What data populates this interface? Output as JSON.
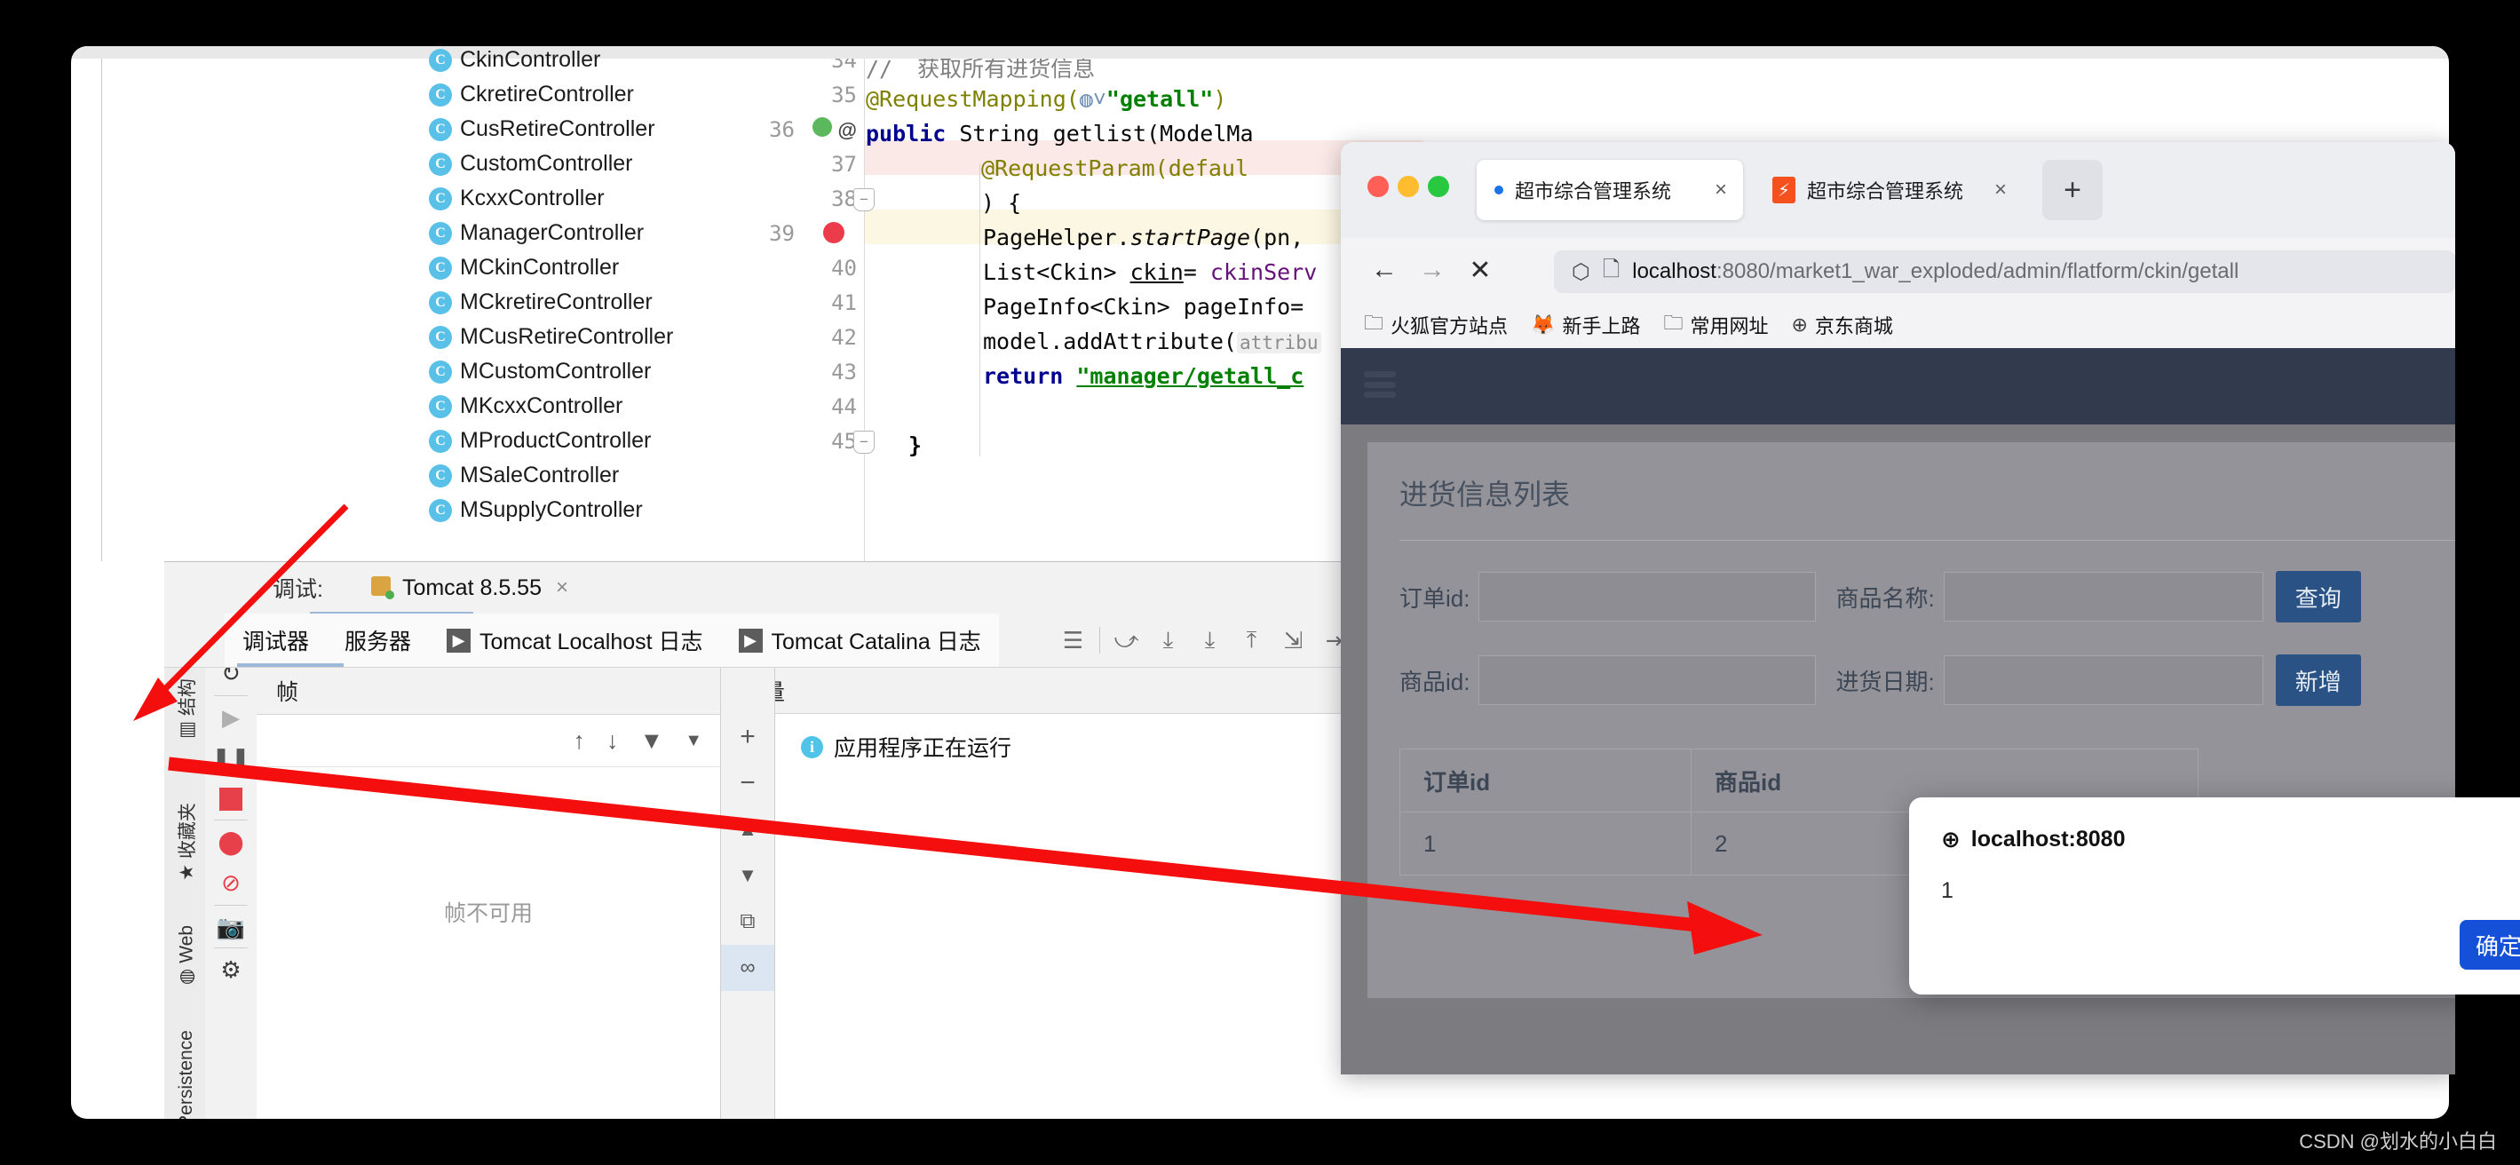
{
  "ide": {
    "project_tree": {
      "items": [
        {
          "label": "CkinController",
          "icon": "class-icon"
        },
        {
          "label": "CkretireController",
          "icon": "class-icon"
        },
        {
          "label": "CusRetireController",
          "icon": "class-icon"
        },
        {
          "label": "CustomController",
          "icon": "class-icon"
        },
        {
          "label": "KcxxController",
          "icon": "class-icon"
        },
        {
          "label": "ManagerController",
          "icon": "class-icon"
        },
        {
          "label": "MCkinController",
          "icon": "class-icon"
        },
        {
          "label": "MCkretireController",
          "icon": "class-icon"
        },
        {
          "label": "MCusRetireController",
          "icon": "class-icon"
        },
        {
          "label": "MCustomController",
          "icon": "class-icon"
        },
        {
          "label": "MKcxxController",
          "icon": "class-icon"
        },
        {
          "label": "MProductController",
          "icon": "class-icon"
        },
        {
          "label": "MSaleController",
          "icon": "class-icon"
        },
        {
          "label": "MSupplyController",
          "icon": "class-icon"
        }
      ]
    },
    "editor": {
      "line_numbers": [
        "34",
        "35",
        "36",
        "37",
        "38",
        "39",
        "40",
        "41",
        "42",
        "43",
        "44",
        "45"
      ],
      "lines": {
        "l34_comment": "//",
        "l34_text": "获取所有进货信息",
        "l35_annotation": "@RequestMapping(",
        "l35_string": "\"getall\"",
        "l35_close": ")",
        "l36_kw": "public",
        "l36_rest": " String getlist(ModelMa",
        "l37": "@RequestParam(defaul",
        "l38": ") {",
        "l39_a": "PageHelper.",
        "l39_b": "startPage",
        "l39_c": "(pn,",
        "l40_a": "List<Ckin> ",
        "l40_b": "ckin",
        "l40_c": "= ",
        "l40_d": "ckinServ",
        "l41": "PageInfo<Ckin> pageInfo=",
        "l42_a": "model.addAttribute(",
        "l42_ph": "attribu",
        "l43_kw": "return",
        "l43_str": "\"manager/getall_c",
        "l45": "}"
      },
      "gutter_icons": {
        "line36": "@",
        "line36_override": "override-icon",
        "line39": "breakpoint-icon"
      }
    },
    "debug_panel": {
      "title_label": "调试:",
      "session_tab": "Tomcat 8.5.55",
      "session_close": "×",
      "sub_tabs": [
        {
          "label": "调试器",
          "icon": ""
        },
        {
          "label": "服务器",
          "icon": ""
        },
        {
          "label": "Tomcat Localhost 日志",
          "icon": "run-icon"
        },
        {
          "label": "Tomcat Catalina 日志",
          "icon": "run-icon"
        }
      ],
      "toolbar_icons": [
        "menu-icon",
        "step-over-icon",
        "step-into-icon",
        "force-step-into-icon",
        "step-out-icon",
        "drop-frame-icon",
        "run-to-cursor-icon",
        "evaluate-icon",
        "settings-lines-icon"
      ],
      "frames_header": "帧",
      "frames_empty": "帧不可用",
      "frames_controls": [
        "arrow-up-icon",
        "arrow-down-icon",
        "filter-icon",
        "chevron-down-icon"
      ],
      "variables_header": "变量",
      "variables_row": "应用程序正在运行",
      "variables_buttons": [
        "plus-icon",
        "minus-icon",
        "chevron-up-icon",
        "chevron-down-icon",
        "copy-icon",
        "watches-icon"
      ],
      "left_rail_labels": [
        "结构",
        "收藏夹",
        "Web",
        "Persistence"
      ],
      "left_rail_icons": [
        "rerun-icon",
        "wrench-icon",
        "restart-icon",
        "resume-icon",
        "pause-icon",
        "stop-icon",
        "breakpoints-icon",
        "mute-breakpoints-icon",
        "camera-icon",
        "settings-gear-icon"
      ]
    }
  },
  "browser": {
    "window_controls": [
      "close",
      "minimize",
      "zoom"
    ],
    "tabs": [
      {
        "title": "超市综合管理系统",
        "active": true,
        "close": "×",
        "favicon": "dot-icon"
      },
      {
        "title": "超市综合管理系统",
        "active": false,
        "close": "×",
        "favicon": "firefox-icon"
      }
    ],
    "new_tab_label": "+",
    "nav": {
      "back": "←",
      "forward": "→",
      "stop": "✕",
      "shield_icon": "shield-icon",
      "page_icon": "page-icon"
    },
    "url": {
      "host": "localhost",
      "rest": ":8080/market1_war_exploded/admin/flatform/ckin/getall"
    },
    "bookmarks": [
      {
        "label": "火狐官方站点",
        "icon": "folder-icon"
      },
      {
        "label": "新手上路",
        "icon": "firefox-icon"
      },
      {
        "label": "常用网址",
        "icon": "folder-icon"
      },
      {
        "label": "京东商城",
        "icon": "globe-icon"
      }
    ],
    "page": {
      "menu_icon": "hamburger-icon",
      "card_title": "进货信息列表",
      "form_rows": [
        {
          "label1": "订单id:",
          "value1": "",
          "placeholder1": "",
          "label2": "商品名称:",
          "value2": "",
          "placeholder2": "",
          "button": "查询"
        },
        {
          "label1": "商品id:",
          "value1": "",
          "placeholder1": "",
          "label2": "进货日期:",
          "value2": "",
          "placeholder2": "",
          "button": "新增"
        }
      ],
      "table": {
        "headers": [
          "订单id",
          "商品id"
        ],
        "rows": [
          [
            "1",
            "2"
          ]
        ]
      }
    },
    "modal": {
      "host": "localhost:8080",
      "message": "1",
      "ok_label": "确定",
      "globe_icon": "globe-icon"
    }
  },
  "watermark": "CSDN @划水的小白白",
  "colors": {
    "accent_blue": "#1450d8",
    "button_blue": "#2a5285",
    "page_dark": "#323b4d",
    "arrow_red": "#f40e0e",
    "class_icon": "#59c1e8"
  }
}
